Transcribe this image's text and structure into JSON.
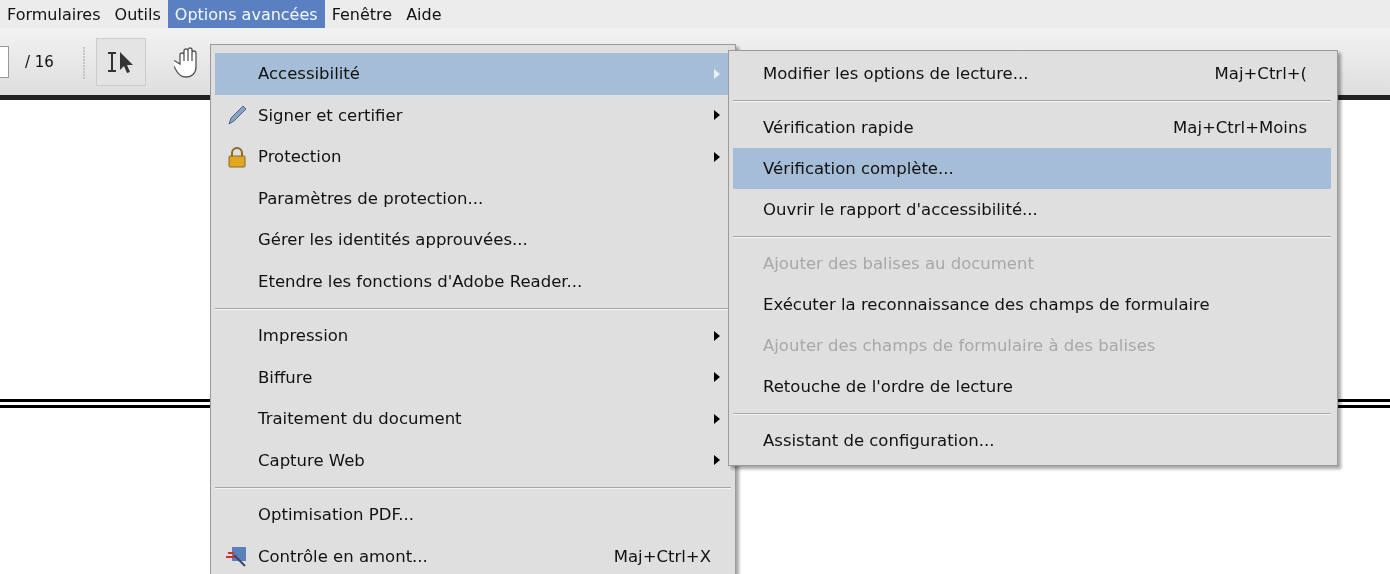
{
  "menu_bar": [
    {
      "label": "Formulaires",
      "selected": false
    },
    {
      "label": "Outils",
      "selected": false
    },
    {
      "label": "Options avancées",
      "selected": true
    },
    {
      "label": "Fenêtre",
      "selected": false
    },
    {
      "label": "Aide",
      "selected": false
    }
  ],
  "toolbar": {
    "page_total": "/ 16",
    "select_tool_pressed": true
  },
  "menu": {
    "sections": [
      [
        {
          "label": "Accessibilité",
          "submenu": true,
          "selected": true,
          "disabled": false
        },
        {
          "label": "Signer et certifier",
          "submenu": true,
          "selected": false,
          "disabled": false
        },
        {
          "label": "Protection",
          "submenu": true,
          "selected": false,
          "disabled": false
        },
        {
          "label": "Paramètres de protection...",
          "submenu": false,
          "selected": false,
          "disabled": false
        },
        {
          "label": "Gérer les identités approuvées...",
          "submenu": false,
          "selected": false,
          "disabled": false
        },
        {
          "label": "Etendre les fonctions d'Adobe Reader...",
          "submenu": false,
          "selected": false,
          "disabled": false
        }
      ],
      [
        {
          "label": "Impression",
          "submenu": true,
          "selected": false,
          "disabled": false
        },
        {
          "label": "Biffure",
          "submenu": true,
          "selected": false,
          "disabled": false
        },
        {
          "label": "Traitement du document",
          "submenu": true,
          "selected": false,
          "disabled": false
        },
        {
          "label": "Capture Web",
          "submenu": true,
          "selected": false,
          "disabled": false
        }
      ],
      [
        {
          "label": "Optimisation PDF...",
          "submenu": false,
          "selected": false,
          "disabled": false
        },
        {
          "label": "Contrôle en amont...",
          "shortcut": "Maj+Ctrl+X",
          "submenu": false,
          "selected": false,
          "disabled": false
        }
      ]
    ]
  },
  "submenu": {
    "sections": [
      [
        {
          "label": "Modifier les options de lecture...",
          "shortcut": "Maj+Ctrl+(",
          "selected": false,
          "disabled": false
        }
      ],
      [
        {
          "label": "Vérification rapide",
          "shortcut": "Maj+Ctrl+Moins",
          "selected": false,
          "disabled": false
        },
        {
          "label": "Vérification complète...",
          "selected": true,
          "disabled": false
        },
        {
          "label": "Ouvrir le rapport d'accessibilité...",
          "selected": false,
          "disabled": false
        }
      ],
      [
        {
          "label": "Ajouter des balises au document",
          "selected": false,
          "disabled": true
        },
        {
          "label": "Exécuter la reconnaissance des champs de formulaire",
          "selected": false,
          "disabled": false
        },
        {
          "label": "Ajouter des champs de formulaire à des balises",
          "selected": false,
          "disabled": true
        },
        {
          "label": "Retouche de l'ordre de lecture",
          "selected": false,
          "disabled": false
        }
      ],
      [
        {
          "label": "Assistant de configuration...",
          "selected": false,
          "disabled": false
        }
      ]
    ]
  }
}
